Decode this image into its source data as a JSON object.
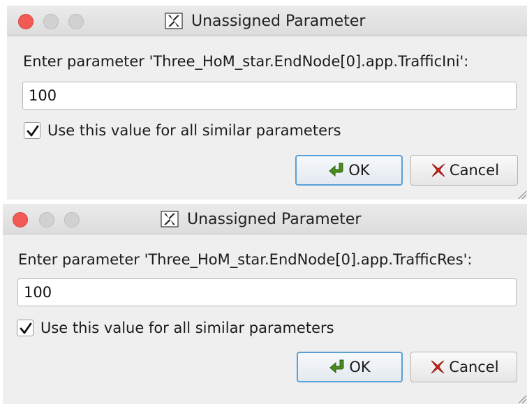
{
  "dialogs": [
    {
      "title": "Unassigned Parameter",
      "prompt": "Enter parameter 'Three_HoM_star.EndNode[0].app.TrafficIni':",
      "value": "100",
      "use_for_all_label": "Use this value for all similar parameters",
      "use_for_all_checked": true,
      "ok_label": "OK",
      "cancel_label": "Cancel"
    },
    {
      "title": "Unassigned Parameter",
      "prompt": "Enter parameter 'Three_HoM_star.EndNode[0].app.TrafficRes':",
      "value": "100",
      "use_for_all_label": "Use this value for all similar parameters",
      "use_for_all_checked": true,
      "ok_label": "OK",
      "cancel_label": "Cancel"
    }
  ],
  "icons": {
    "window_icon": "x11-icon",
    "ok_icon": "green-arrow-icon",
    "cancel_icon": "red-x-icon"
  },
  "colors": {
    "close_button": "#f25a56",
    "default_button_border": "#5a9fd6",
    "ok_arrow": "#4a8c1f",
    "cancel_x": "#c8251b"
  }
}
